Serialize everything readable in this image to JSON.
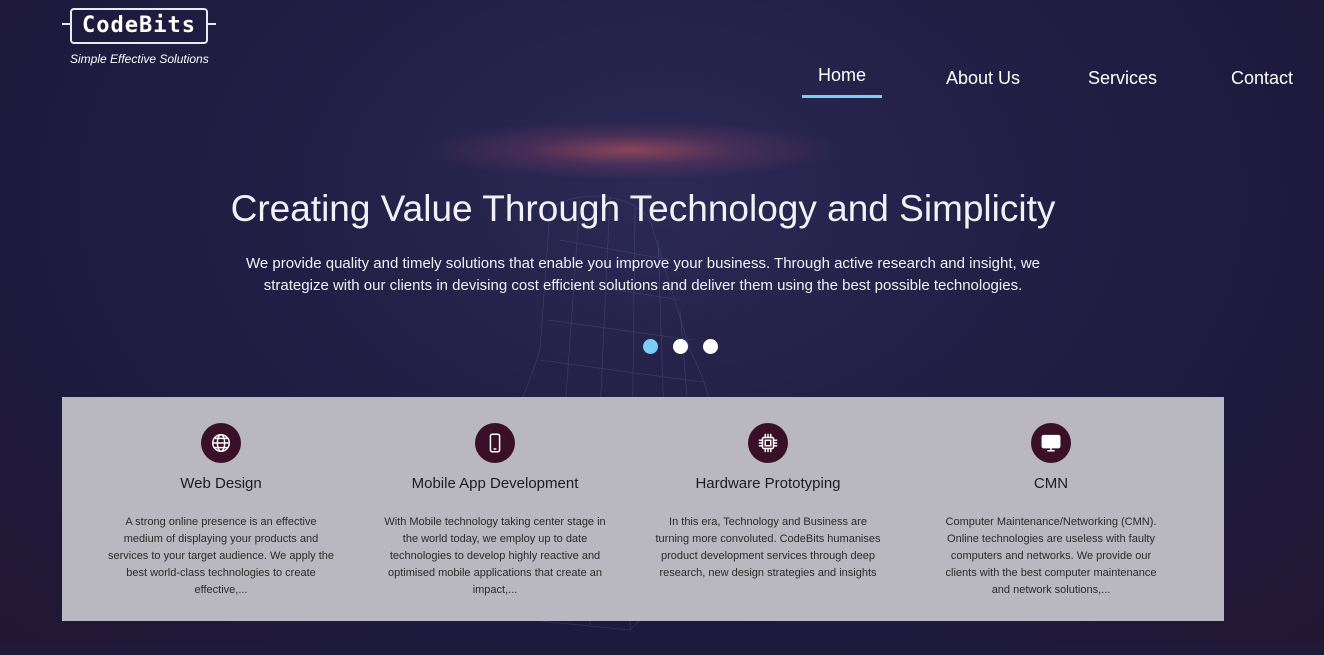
{
  "brand": {
    "logo_text": "CodeBits",
    "tagline": "Simple Effective Solutions"
  },
  "nav": {
    "items": [
      {
        "label": "Home",
        "active": true
      },
      {
        "label": "About Us",
        "active": false
      },
      {
        "label": "Services",
        "active": false
      },
      {
        "label": "Contact",
        "active": false
      }
    ]
  },
  "hero": {
    "title": "Creating Value Through Technology and Simplicity",
    "description": "We provide quality and timely solutions that enable you improve your business. Through active research and insight, we strategize with our clients in devising cost efficient solutions and deliver them using the best possible technologies."
  },
  "carousel": {
    "slide_count": 3,
    "active_index": 0
  },
  "services": [
    {
      "icon": "globe-icon",
      "title": "Web Design",
      "description": "A strong online presence is an effective medium of displaying your products and services to your target audience. We apply the best world-class technologies to create effective,..."
    },
    {
      "icon": "mobile-phone-icon",
      "title": "Mobile App Development",
      "description": "With Mobile technology taking center stage in the world today, we employ up to date technologies to develop highly reactive and optimised mobile applications that create an impact,..."
    },
    {
      "icon": "chip-icon",
      "title": "Hardware Prototyping",
      "description": "In this era, Technology and Business are turning more convoluted. CodeBits humanises product development services through deep research, new design strategies and insights"
    },
    {
      "icon": "monitor-icon",
      "title": "CMN",
      "description": "Computer Maintenance/Networking (CMN). Online technologies are useless with faulty computers and networks. We provide our clients with the best computer maintenance and network solutions,..."
    }
  ],
  "colors": {
    "accent": "#7ccdf3",
    "icon_circle": "#3a1029",
    "services_panel": "#b9b7bf",
    "background": "#211f45"
  }
}
